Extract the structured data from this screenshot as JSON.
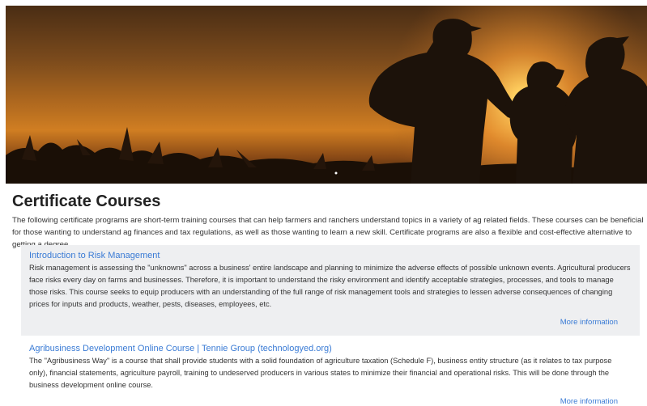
{
  "hero": {
    "image": "farmers-at-sunset-photo"
  },
  "page": {
    "title": "Certificate Courses",
    "intro": "The following certificate programs are short-term training courses that can help farmers and ranchers understand topics in a variety of ag related fields. These courses can be beneficial for those wanting to understand ag finances and tax regulations, as well as those wanting to learn a new skill. Certificate programs are also a flexible and cost-effective alternative to getting a degree."
  },
  "courses": [
    {
      "title": "Introduction to Risk Management",
      "description": "Risk management is assessing the \"unknowns\" across a business' entire landscape and planning to minimize the adverse effects of possible unknown events. Agricultural producers face risks every day on farms and businesses. Therefore, it is important to understand the risky environment and identify acceptable strategies, processes, and tools to manage those risks. This course seeks to equip producers with an understanding of the full range of risk management tools and strategies to lessen adverse consequences of changing prices for inputs and products, weather, pests, diseases, employees, etc.",
      "link_label": "More information"
    },
    {
      "title": "Agribusiness Development Online Course | Tennie Group (technologyed.org)",
      "description": "The \"Agribusiness Way\" is a course that shall provide students with a solid foundation of agriculture taxation (Schedule F), business entity structure (as it relates to tax purpose only), financial statements, agriculture payroll, training to undeserved producers in various states to minimize their financial and operational risks. This will be done through the business development online course.",
      "link_label": "More information"
    }
  ],
  "colors": {
    "link": "#3a7bd5",
    "card_bg": "#eeeff1"
  }
}
